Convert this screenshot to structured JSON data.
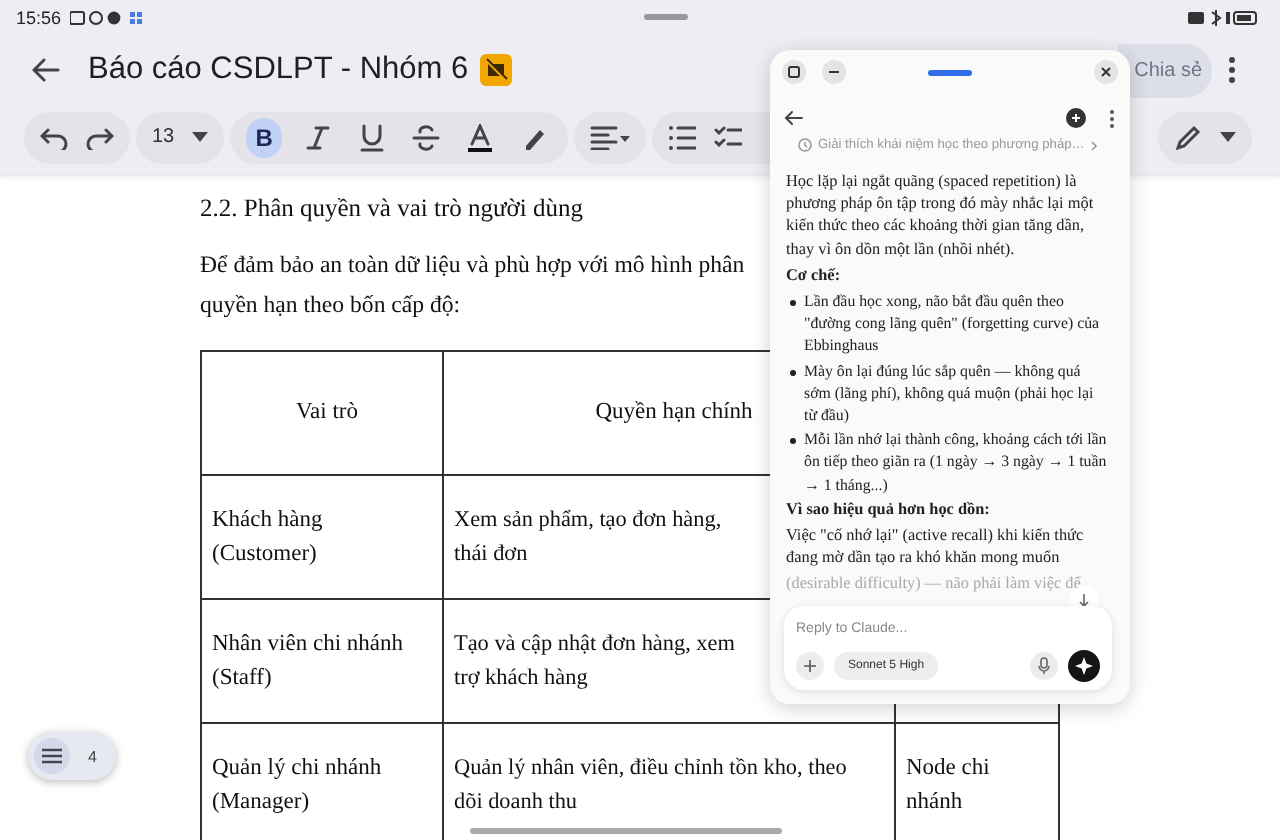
{
  "status_bar": {
    "time": "15:56"
  },
  "doc_header": {
    "title": "Báo cáo CSDLPT - Nhóm 6",
    "share_button": "Chia sẻ"
  },
  "toolbar": {
    "font_size": "13",
    "format_buttons": [
      {
        "kind": "bold",
        "label": "B",
        "selected": true
      },
      {
        "kind": "italic",
        "selected": false
      },
      {
        "kind": "underline",
        "selected": false
      },
      {
        "kind": "strike",
        "selected": false
      },
      {
        "kind": "color",
        "selected": false
      },
      {
        "kind": "highlight",
        "selected": false
      }
    ]
  },
  "document": {
    "heading": "2.2. Phân quyền và vai trò người dùng",
    "paragraph_lines": [
      "Để đảm bảo an toàn dữ liệu và phù hợp với mô hình phân",
      "quyền hạn theo bốn cấp độ:"
    ],
    "table": {
      "columns": [
        "Vai trò",
        "Quyền hạn chính"
      ],
      "rows": [
        {
          "role": [
            "Khách hàng",
            "(Customer)"
          ],
          "permissions": [
            "Xem sản phẩm, tạo đơn hàng,",
            "thái đơn"
          ]
        },
        {
          "role": [
            "Nhân viên chi nhánh",
            "(Staff)"
          ],
          "permissions": [
            "Tạo và cập nhật đơn hàng, xem",
            "trợ khách hàng"
          ]
        },
        {
          "role": [
            "Quản lý chi nhánh",
            "(Manager)"
          ],
          "permissions": [
            "Quản lý nhân viên, điều chỉnh tồn kho, theo",
            "dõi doanh thu"
          ],
          "column_3": [
            "Node chi",
            "nhánh"
          ]
        }
      ]
    }
  },
  "outline_button": {
    "count": "4"
  },
  "chat_window": {
    "breadcrumb": "Giải thích khái niệm học theo phương pháp…",
    "blocks": [
      {
        "kind": "paragraph",
        "text": "Học lặp lại ngắt quãng (spaced repetition) là phương pháp ôn tập trong đó mày nhắc lại một kiến thức theo các khoảng thời gian tăng dần, thay vì ôn dồn một lần (nhồi nhét)."
      },
      {
        "kind": "heading",
        "text": "Cơ chế:"
      },
      {
        "kind": "bullet",
        "text": "Lần đầu học xong, não bắt đầu quên theo \"đường cong lãng quên\" (forgetting curve) của Ebbinghaus"
      },
      {
        "kind": "bullet",
        "text": "Mày ôn lại đúng lúc sắp quên — không quá sớm (lãng phí), không quá muộn (phải học lại từ đầu)"
      },
      {
        "kind": "bullet",
        "text": "Mỗi lần nhớ lại thành công, khoảng cách tới lần ôn tiếp theo giãn ra (1 ngày → 3 ngày → 1 tuần → 1 tháng...)"
      },
      {
        "kind": "heading",
        "text": "Vì sao hiệu quả hơn học dồn:"
      },
      {
        "kind": "paragraph",
        "text": "Việc \"cố nhớ lại\" (active recall) khi kiến thức đang mờ dần tạo ra khó khăn mong muốn"
      },
      {
        "kind": "faded",
        "text": "(desirable difficulty) — não phải làm việc để"
      }
    ],
    "input": {
      "placeholder": "Reply to Claude...",
      "model": "Sonnet 5 High"
    }
  }
}
